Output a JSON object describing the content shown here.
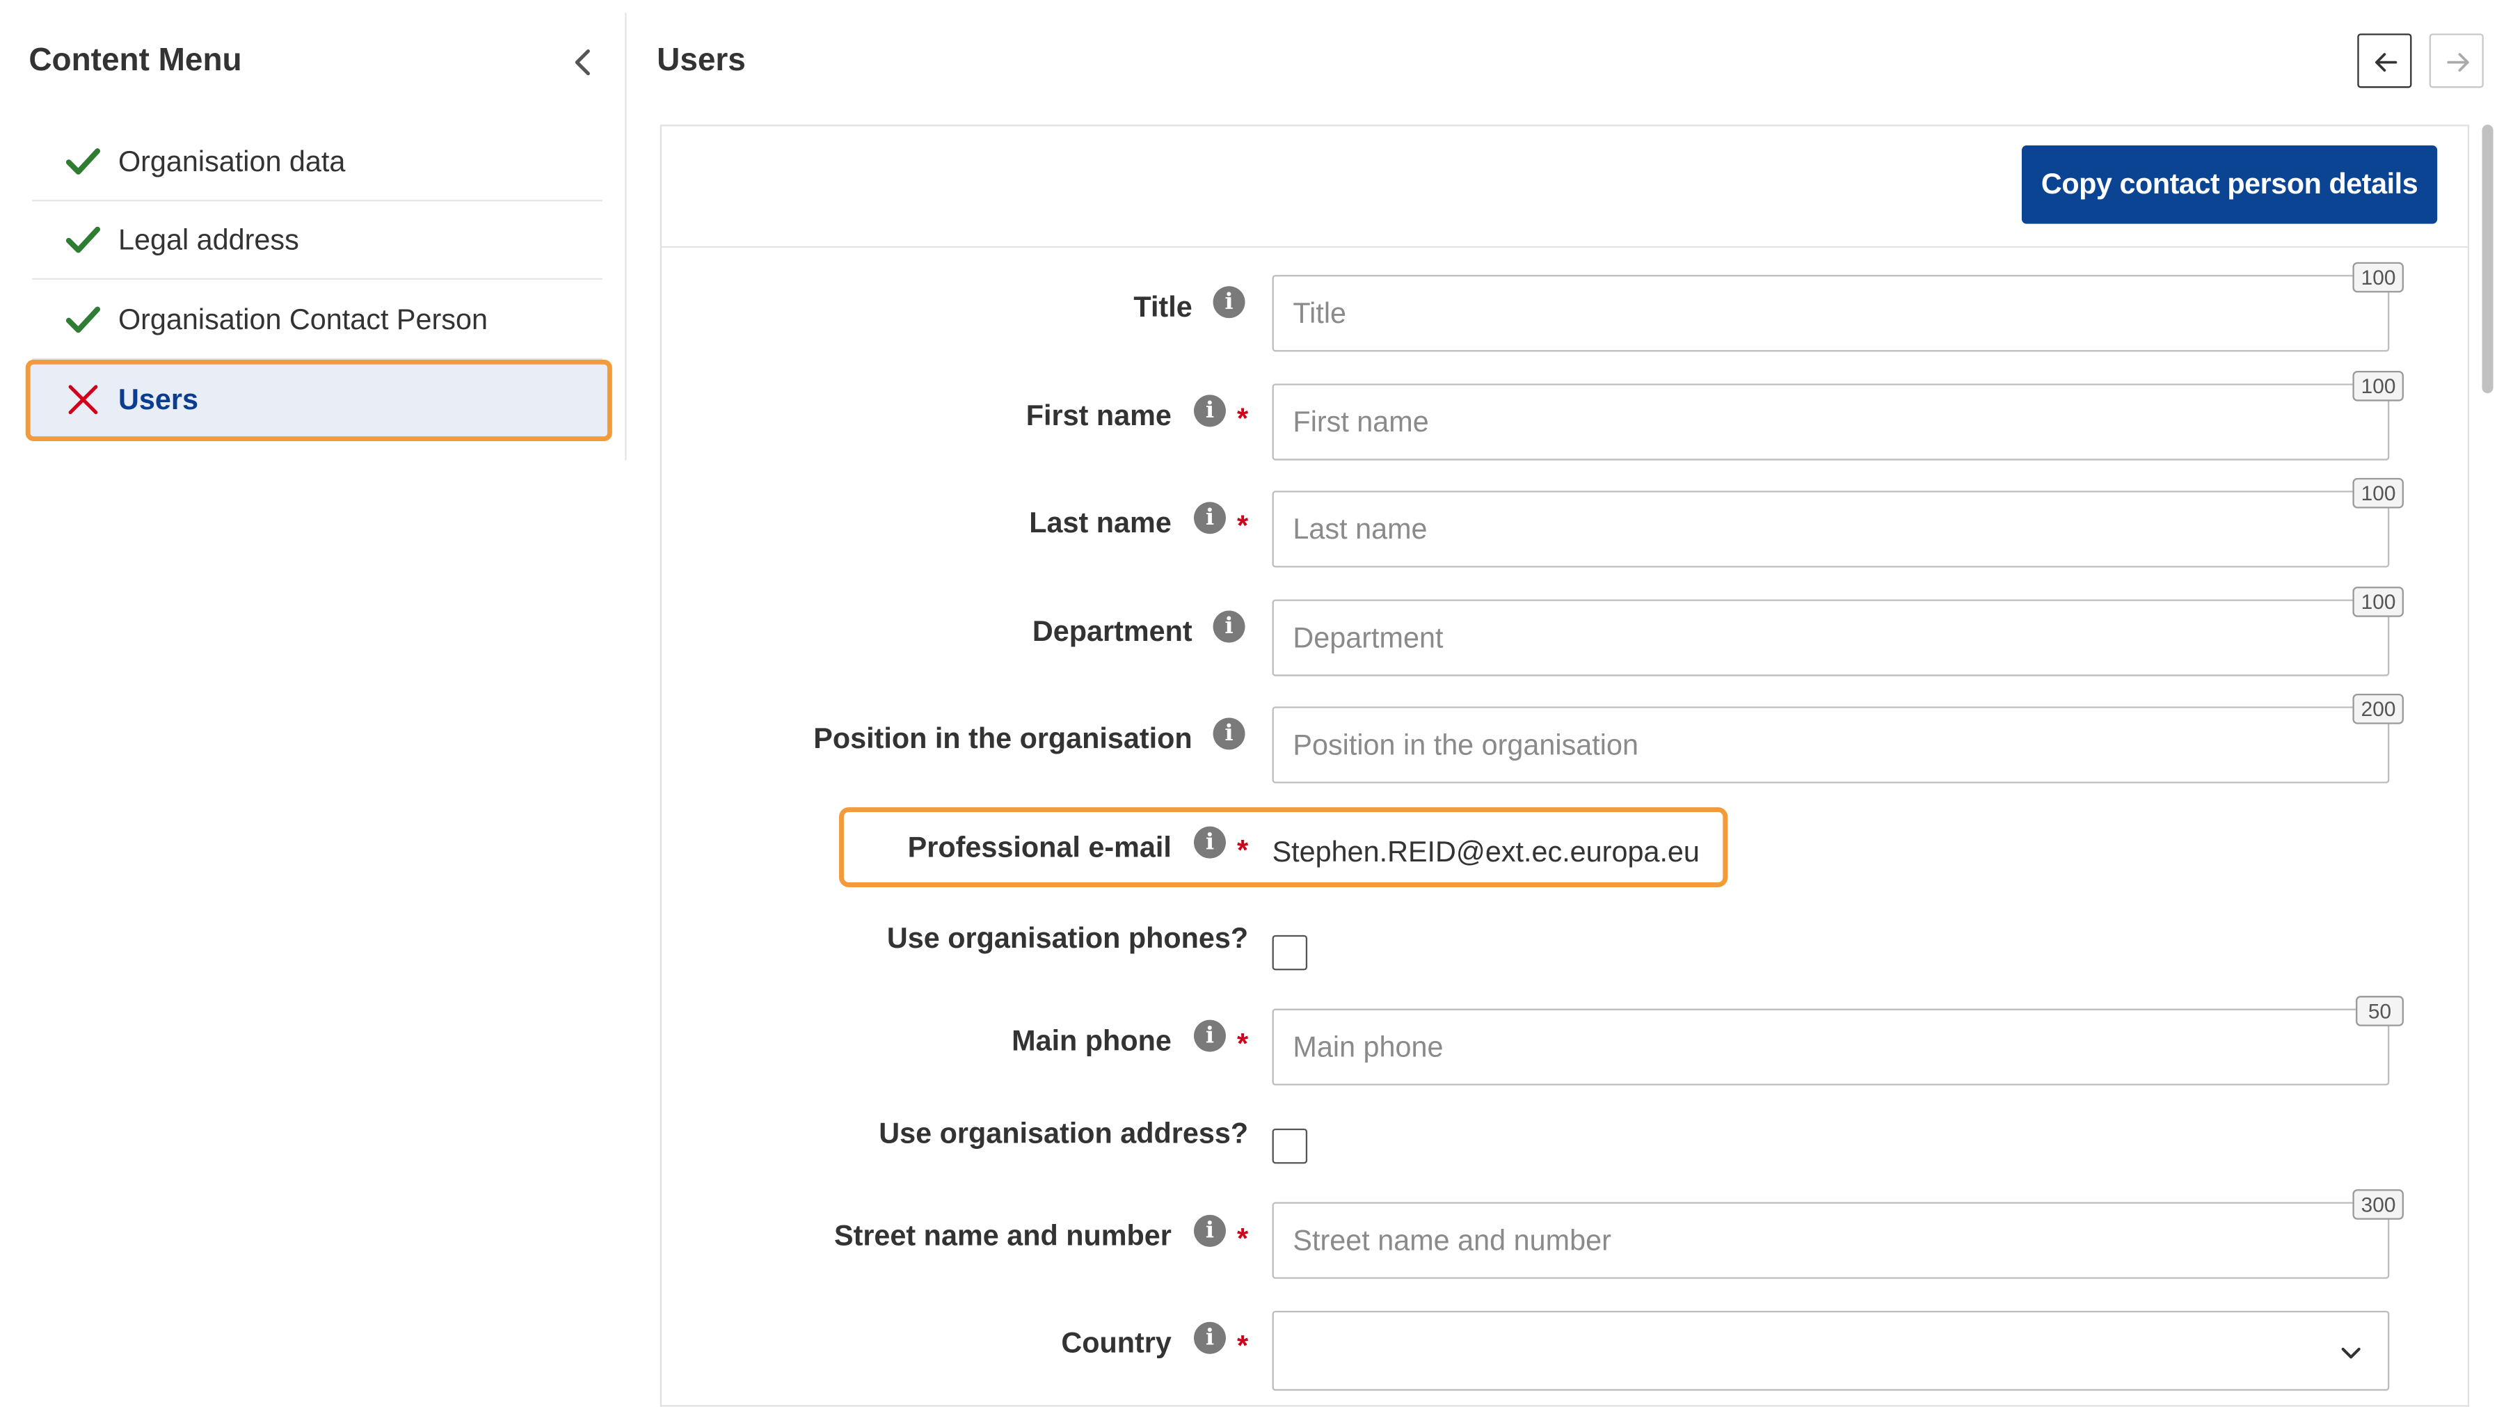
{
  "sidebar": {
    "title": "Content Menu",
    "items": [
      {
        "label": "Organisation data",
        "status": "complete"
      },
      {
        "label": "Legal address",
        "status": "complete"
      },
      {
        "label": "Organisation Contact Person",
        "status": "complete"
      },
      {
        "label": "Users",
        "status": "error",
        "active": true
      }
    ]
  },
  "header": {
    "title": "Users"
  },
  "actions": {
    "copy_label": "Copy contact person details"
  },
  "form": {
    "title": {
      "label": "Title",
      "placeholder": "Title",
      "max": "100"
    },
    "first_name": {
      "label": "First name",
      "placeholder": "First name",
      "max": "100"
    },
    "last_name": {
      "label": "Last name",
      "placeholder": "Last name",
      "max": "100"
    },
    "department": {
      "label": "Department",
      "placeholder": "Department",
      "max": "100"
    },
    "position": {
      "label": "Position in the organisation",
      "placeholder": "Position in the organisation",
      "max": "200"
    },
    "email": {
      "label": "Professional e-mail",
      "value": "Stephen.REID@ext.ec.europa.eu"
    },
    "use_org_phones": {
      "label": "Use organisation phones?"
    },
    "main_phone": {
      "label": "Main phone",
      "placeholder": "Main phone",
      "max": "50"
    },
    "use_org_address": {
      "label": "Use organisation address?"
    },
    "street": {
      "label": "Street name and number",
      "placeholder": "Street name and number",
      "max": "300"
    },
    "country": {
      "label": "Country"
    }
  },
  "colors": {
    "accent": "#0a4493",
    "highlight": "#f39a3a",
    "check": "#2e7d32",
    "error": "#d0021b"
  },
  "icons": {
    "complete": "check-icon",
    "error": "cross-icon",
    "info": "info-icon"
  }
}
